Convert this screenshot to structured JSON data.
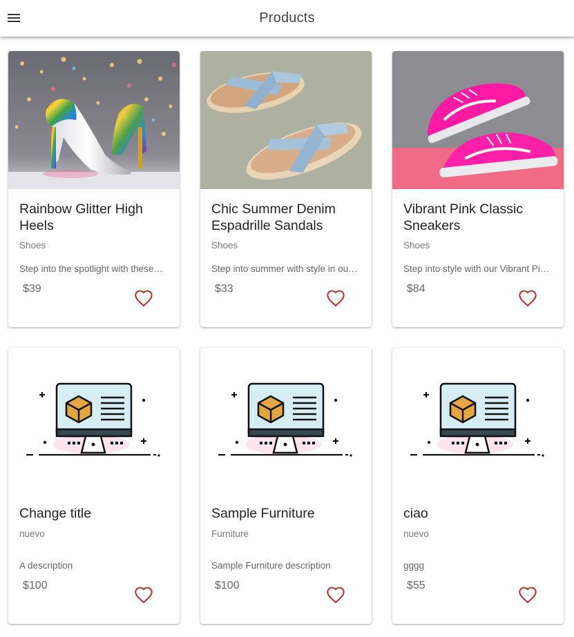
{
  "appbar": {
    "title": "Products",
    "menu_icon": "menu-icon"
  },
  "colors": {
    "heart": "#c62828",
    "accent_pink": "#ff1493"
  },
  "products": [
    {
      "title": "Rainbow Glitter High Heels",
      "category": "Shoes",
      "description": "Step into the spotlight with these…",
      "price": "$39",
      "image": "rainbow-heels-photo"
    },
    {
      "title": "Chic Summer Denim Espadrille Sandals",
      "category": "Shoes",
      "description": "Step into summer with style in ou…",
      "price": "$33",
      "image": "denim-sandals-photo"
    },
    {
      "title": "Vibrant Pink Classic Sneakers",
      "category": "Shoes",
      "description": "Step into style with our Vibrant Pi…",
      "price": "$84",
      "image": "pink-sneakers-photo"
    },
    {
      "title": "Change title",
      "category": "nuevo",
      "description": "A description",
      "price": "$100",
      "image": "placeholder-computer-illustration"
    },
    {
      "title": "Sample Furniture",
      "category": "Furniture",
      "description": "Sample Furniture description",
      "price": "$100",
      "image": "placeholder-computer-illustration"
    },
    {
      "title": "ciao",
      "category": "nuevo",
      "description": "gggg",
      "price": "$55",
      "image": "placeholder-computer-illustration"
    }
  ]
}
